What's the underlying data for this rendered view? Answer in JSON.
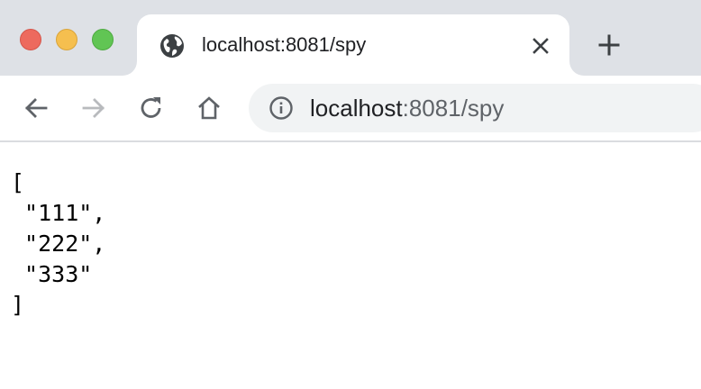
{
  "tab": {
    "title": "localhost:8081/spy",
    "favicon": "globe-icon",
    "close": "close-icon"
  },
  "new_tab": "plus-icon",
  "toolbar": {
    "back": "arrow-left-icon",
    "forward": "arrow-right-icon",
    "reload": "reload-icon",
    "home": "home-icon"
  },
  "address_bar": {
    "info_icon": "info-icon",
    "host": "localhost",
    "path": ":8081/spy"
  },
  "page": {
    "lines": [
      "[",
      " \"111\",",
      " \"222\",",
      " \"333\"",
      "]"
    ]
  },
  "colors": {
    "tabstrip": "#dee1e6",
    "traffic_close": "#ed6a5e",
    "traffic_min": "#f5bf4f",
    "traffic_max": "#61c554",
    "omnibox": "#f1f3f4"
  }
}
